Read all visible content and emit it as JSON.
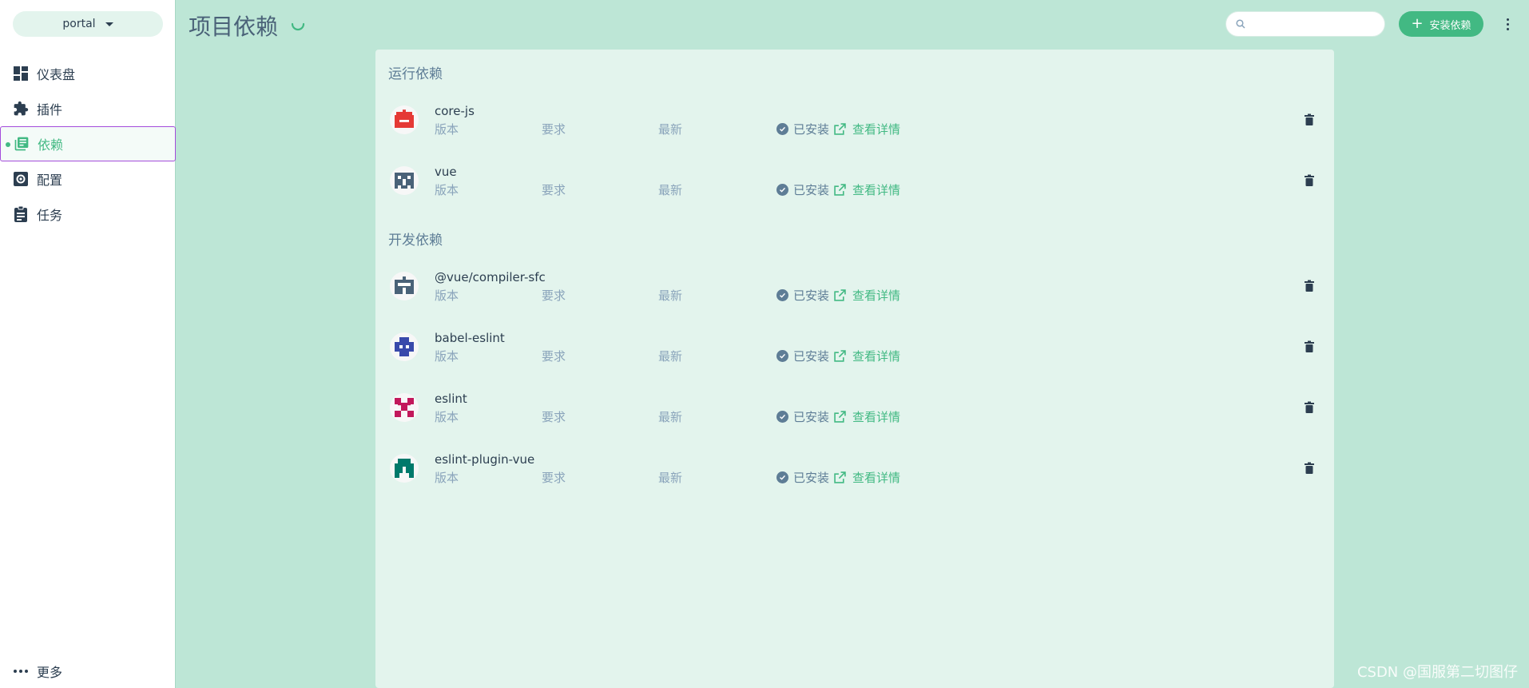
{
  "sidebar": {
    "project": "portal",
    "items": [
      {
        "label": "仪表盘",
        "icon": "dashboard-icon"
      },
      {
        "label": "插件",
        "icon": "puzzle-icon"
      },
      {
        "label": "依赖",
        "icon": "library-books-icon",
        "active": true
      },
      {
        "label": "配置",
        "icon": "settings-icon"
      },
      {
        "label": "任务",
        "icon": "clipboard-icon"
      }
    ],
    "more_label": "更多"
  },
  "header": {
    "title": "项目依赖",
    "search_placeholder": "",
    "install_label": "安装依赖"
  },
  "sections": [
    {
      "title": "运行依赖",
      "dependencies": [
        {
          "name": "core-js",
          "color": "#e53935"
        },
        {
          "name": "vue",
          "color": "#4a6278"
        }
      ]
    },
    {
      "title": "开发依赖",
      "dependencies": [
        {
          "name": "@vue/compiler-sfc",
          "color": "#4a6278"
        },
        {
          "name": "babel-eslint",
          "color": "#3949ab"
        },
        {
          "name": "eslint",
          "color": "#c2185b"
        },
        {
          "name": "eslint-plugin-vue",
          "color": "#00796b"
        }
      ]
    }
  ],
  "dep_labels": {
    "version": "版本",
    "required": "要求",
    "latest": "最新",
    "installed": "已安装",
    "details": "查看详情"
  },
  "watermark": "CSDN @国服第二切图仔",
  "colors": {
    "accent": "#42b983",
    "background": "#bde6d6",
    "panel": "#e3f4ed",
    "active_outline": "#a44cdb"
  }
}
